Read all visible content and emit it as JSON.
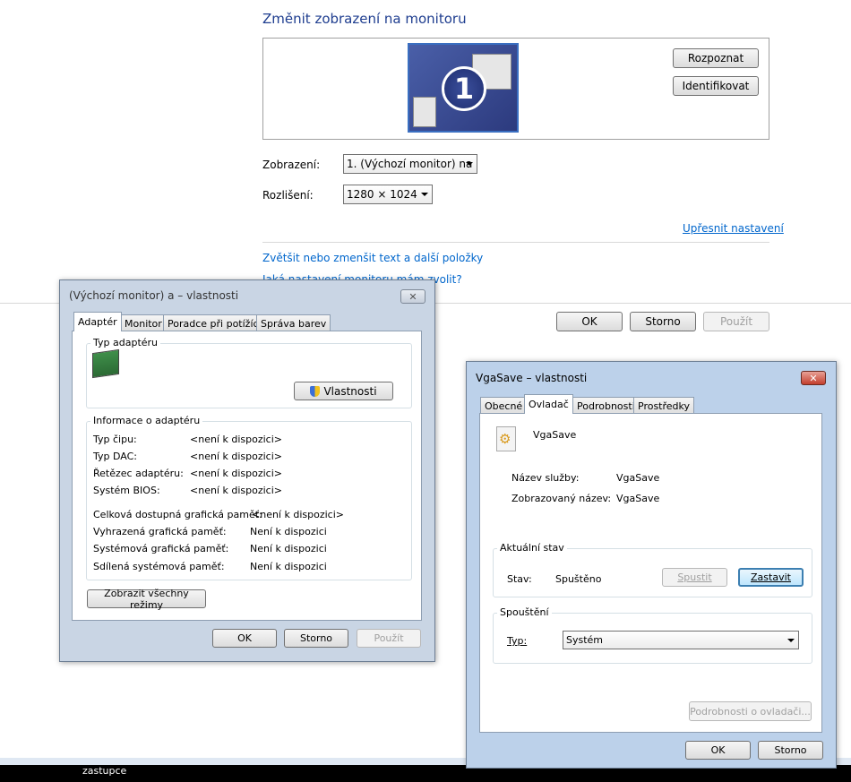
{
  "main": {
    "heading": "Změnit zobrazení na monitoru",
    "recognize_button": "Rozpoznat",
    "identify_button": "Identifikovat",
    "monitor_number": "1",
    "display_label": "Zobrazení:",
    "display_value": "1. (Výchozí monitor) na",
    "resolution_label": "Rozlišení:",
    "resolution_value": "1280 × 1024",
    "advanced_link": "Upřesnit nastavení",
    "text_size_link": "Zvětšit nebo zmenšit text a další položky",
    "monitor_settings_link": "Jaká nastavení monitoru mám zvolit?",
    "ok": "OK",
    "cancel": "Storno",
    "apply": "Použít",
    "taskbar_text": "zastupce"
  },
  "adapter_dialog": {
    "title": "(Výchozí monitor) a  – vlastnosti",
    "tabs": [
      "Adaptér",
      "Monitor",
      "Poradce při potížích",
      "Správa barev"
    ],
    "adapter_type_group": "Typ adaptéru",
    "properties_button": "Vlastnosti",
    "info_group": "Informace o adaptéru",
    "info_rows": [
      {
        "label": "Typ čipu:",
        "value": "<není k dispozici>"
      },
      {
        "label": "Typ DAC:",
        "value": "<není k dispozici>"
      },
      {
        "label": "Řetězec adaptéru:",
        "value": "<není k dispozici>"
      },
      {
        "label": "Systém BIOS:",
        "value": "<není k dispozici>"
      }
    ],
    "total_mem_label": "Celková dostupná grafická paměť:",
    "total_mem_value": "<není k dispozici>",
    "mem_rows": [
      {
        "label": "Vyhrazená grafická paměť:",
        "value": "Není k dispozici"
      },
      {
        "label": "Systémová grafická paměť:",
        "value": "Není k dispozici"
      },
      {
        "label": "Sdílená systémová paměť:",
        "value": "Není k dispozici"
      }
    ],
    "list_modes_button": "Zobrazit všechny režimy",
    "ok": "OK",
    "cancel": "Storno",
    "apply": "Použít"
  },
  "vga_dialog": {
    "title": "VgaSave – vlastnosti",
    "tabs": [
      "Obecné",
      "Ovladač",
      "Podrobnosti",
      "Prostředky"
    ],
    "driver_name": "VgaSave",
    "service_name_label": "Název služby:",
    "service_name_value": "VgaSave",
    "display_name_label": "Zobrazovaný název:",
    "display_name_value": "VgaSave",
    "current_state_group": "Aktuální stav",
    "state_label": "Stav:",
    "state_value": "Spuštěno",
    "start_button": "Spustit",
    "stop_button": "Zastavit",
    "startup_group": "Spouštění",
    "type_label": "Typ:",
    "type_value": "Systém",
    "driver_details_button": "Podrobnosti o ovladači...",
    "ok": "OK",
    "cancel": "Storno"
  }
}
